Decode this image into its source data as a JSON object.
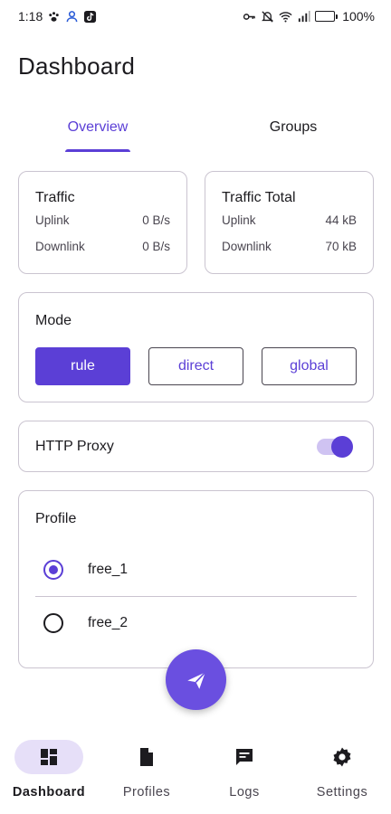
{
  "status_bar": {
    "time": "1:18",
    "battery": "100%",
    "battery_level": 1.0
  },
  "page": {
    "title": "Dashboard"
  },
  "tabs": [
    {
      "label": "Overview",
      "active": true
    },
    {
      "label": "Groups",
      "active": false
    }
  ],
  "traffic": {
    "title": "Traffic",
    "rows": [
      {
        "label": "Uplink",
        "value": "0 B/s"
      },
      {
        "label": "Downlink",
        "value": "0 B/s"
      }
    ]
  },
  "traffic_total": {
    "title": "Traffic Total",
    "rows": [
      {
        "label": "Uplink",
        "value": "44 kB"
      },
      {
        "label": "Downlink",
        "value": "70 kB"
      }
    ]
  },
  "mode": {
    "title": "Mode",
    "options": [
      "rule",
      "direct",
      "global"
    ],
    "selected": "rule"
  },
  "http_proxy": {
    "label": "HTTP Proxy",
    "enabled": true
  },
  "profile": {
    "title": "Profile",
    "items": [
      {
        "label": "free_1",
        "checked": true
      },
      {
        "label": "free_2",
        "checked": false
      }
    ]
  },
  "fab": {
    "icon": "send-icon"
  },
  "bottom_nav": [
    {
      "label": "Dashboard",
      "icon": "dashboard-icon",
      "active": true
    },
    {
      "label": "Profiles",
      "icon": "file-icon",
      "active": false
    },
    {
      "label": "Logs",
      "icon": "chat-icon",
      "active": false
    },
    {
      "label": "Settings",
      "icon": "gear-icon",
      "active": false
    }
  ],
  "colors": {
    "primary": "#5b3fd6",
    "fab": "#6a4fe0",
    "nav_active_bg": "#e6dff8",
    "outline": "#cac4d0"
  }
}
